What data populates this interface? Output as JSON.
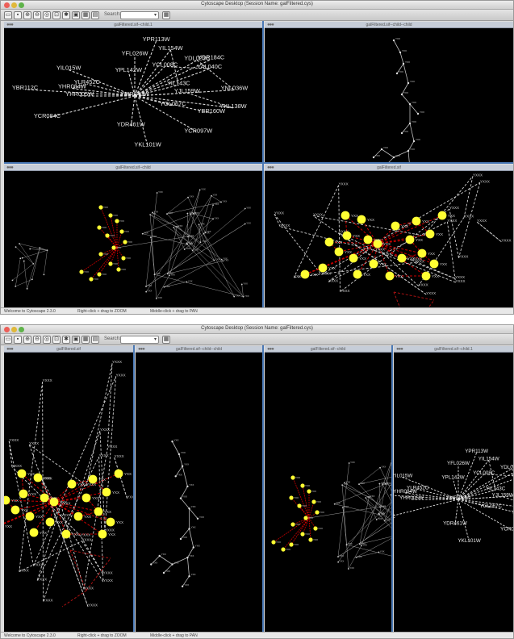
{
  "app": {
    "window_title": "Cytoscape Desktop (Session Name: galFiltered.cys)",
    "search_label": "Search:",
    "toolbar_icons": [
      "folder-open-icon",
      "save-icon",
      "zoom-in-icon",
      "zoom-out-icon",
      "zoom-selected-icon",
      "zoom-fit-icon",
      "network-icon",
      "new-network-icon",
      "layout-icon",
      "filter-icon"
    ]
  },
  "screenshot_a": {
    "panes": [
      {
        "title": "galFiltered.sif--child.1"
      },
      {
        "title": "galFiltered.sif--child--child"
      },
      {
        "title": "galFiltered.sif--child"
      },
      {
        "title": "galFiltered.sif"
      }
    ],
    "status": {
      "welcome": "Welcome to Cytoscape 2.3.0",
      "right_hint": "Right-click + drag to ZOOM",
      "middle_hint": "Middle-click + drag to PAN"
    }
  },
  "screenshot_b": {
    "panes": [
      {
        "title": "galFiltered.sif"
      },
      {
        "title": "galFiltered.sif--child--child"
      },
      {
        "title": "galFiltered.sif--child"
      },
      {
        "title": "galFiltered.sif--child.1"
      }
    ],
    "status": {
      "welcome": "Welcome to Cytoscape 2.3.0",
      "right_hint": "Right-click + drag to ZOOM",
      "middle_hint": "Middle-click + drag to PAN"
    }
  },
  "network_labels": [
    "YDR184C",
    "YAL040C",
    "YCL008C",
    "YPR113W",
    "YIL154W",
    "YIL143C",
    "YDL023C",
    "YNL036W",
    "YFL026W",
    "YPL142W",
    "YMR043W",
    "YJL159W",
    "YKL138W",
    "YIL015W",
    "YBR160W",
    "YHR084W",
    "YLR452C",
    "YGL067C",
    "YHR005W",
    "YCR097W",
    "YDR461W",
    "YBR112C",
    "YCR084C",
    "YKL101W"
  ],
  "colors": {
    "canvas": "#000000",
    "node_highlight": "#ffff33",
    "edge_highlight": "#cc0000",
    "edge_default": "#bbbbbb",
    "divider": "#4a79b6"
  }
}
